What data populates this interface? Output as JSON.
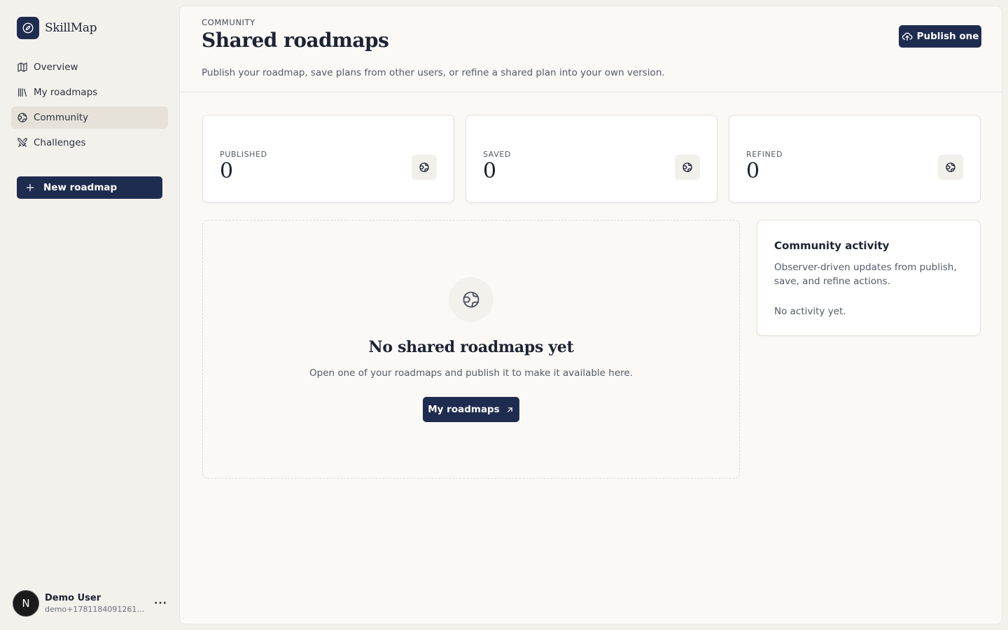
{
  "app": {
    "name": "SkillMap"
  },
  "sidebar": {
    "items": [
      {
        "label": "Overview",
        "icon": "map-icon"
      },
      {
        "label": "My roadmaps",
        "icon": "library-icon"
      },
      {
        "label": "Community",
        "icon": "globe-icon",
        "active": true
      },
      {
        "label": "Challenges",
        "icon": "swords-icon"
      }
    ],
    "new_button": "New roadmap"
  },
  "user": {
    "initial": "N",
    "name": "Demo User",
    "email": "demo+1781184091261@s...",
    "more": "···"
  },
  "header": {
    "eyebrow": "COMMUNITY",
    "title": "Shared roadmaps",
    "description": "Publish your roadmap, save plans from other users, or refine a shared plan into your own version.",
    "publish_button": "Publish one"
  },
  "stats": [
    {
      "label": "PUBLISHED",
      "value": "0"
    },
    {
      "label": "SAVED",
      "value": "0"
    },
    {
      "label": "REFINED",
      "value": "0"
    }
  ],
  "empty_state": {
    "title": "No shared roadmaps yet",
    "description": "Open one of your roadmaps and publish it to make it available here.",
    "button": "My roadmaps"
  },
  "activity": {
    "title": "Community activity",
    "description": "Observer-driven updates from publish, save, and refine actions.",
    "empty": "No activity yet."
  },
  "colors": {
    "accent": "#1e2d4f",
    "background": "#f3f1ec",
    "surface": "#faf9f6"
  }
}
